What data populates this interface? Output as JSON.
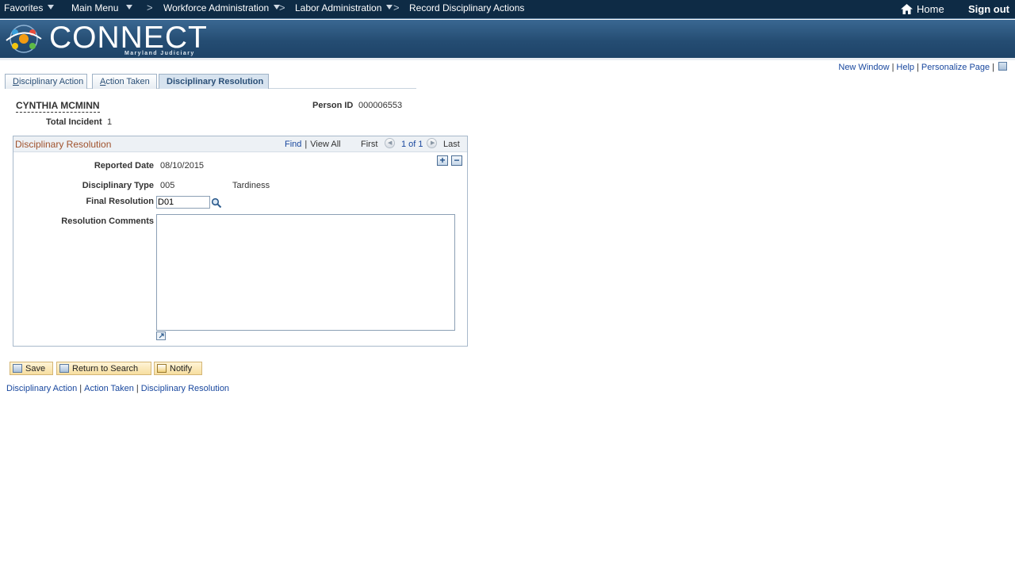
{
  "topnav": {
    "favorites": "Favorites",
    "main_menu": "Main Menu",
    "chevron": ">",
    "crumb1": "Workforce Administration",
    "crumb2": "Labor Administration",
    "crumb3": "Record Disciplinary Actions",
    "home": "Home",
    "signout": "Sign out"
  },
  "banner": {
    "logo_text": "CONNECT",
    "logo_sub": "Maryland Judiciary"
  },
  "util": {
    "new_window": "New Window",
    "help": "Help",
    "personalize": "Personalize Page",
    "sep": "|"
  },
  "tabs": [
    {
      "first": "D",
      "rest": "isciplinary Action"
    },
    {
      "first": "A",
      "rest": "ction Taken"
    },
    {
      "label": "Disciplinary Resolution"
    }
  ],
  "header": {
    "name": "CYNTHIA MCMINN",
    "person_id_label": "Person ID",
    "person_id": "000006553",
    "total_incident_label": "Total Incident",
    "total_incident": "1"
  },
  "scroll": {
    "title": "Disciplinary Resolution",
    "find": "Find",
    "view_all": "View All",
    "sep": "|",
    "first": "First",
    "count": "1 of 1",
    "last": "Last",
    "add": "+",
    "remove": "−"
  },
  "fields": {
    "reported_date_label": "Reported Date",
    "reported_date": "08/10/2015",
    "disc_type_label": "Disciplinary Type",
    "disc_type_code": "005",
    "disc_type_desc": "Tardiness",
    "final_resolution_label": "Final Resolution",
    "final_resolution": "D01",
    "comments_label": "Resolution Comments",
    "comments": ""
  },
  "toolbar": {
    "save": "Save",
    "return": "Return to Search",
    "notify": "Notify"
  },
  "bottom_links": {
    "l1": "Disciplinary Action",
    "l2": "Action Taken",
    "l3": "Disciplinary Resolution",
    "sep": "|"
  }
}
